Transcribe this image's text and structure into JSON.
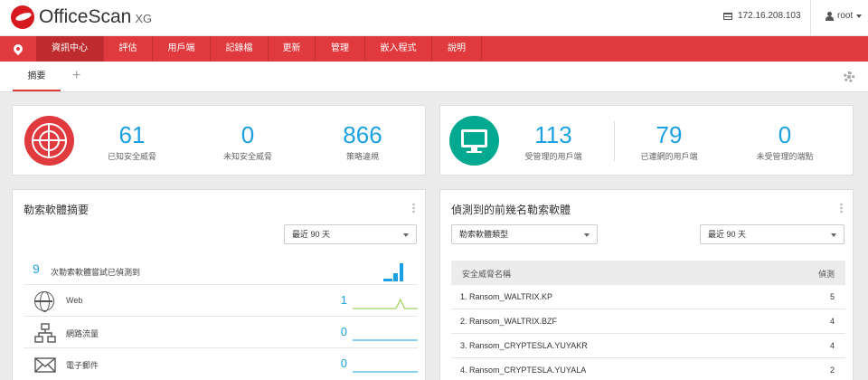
{
  "header": {
    "app_name": "OfficeScan",
    "version": "XG",
    "server_ip": "172.16.208.103",
    "user": "root"
  },
  "nav": {
    "items": [
      {
        "label": "資訊中心",
        "active": true
      },
      {
        "label": "評估"
      },
      {
        "label": "用戶端"
      },
      {
        "label": "記錄檔"
      },
      {
        "label": "更新"
      },
      {
        "label": "管理"
      },
      {
        "label": "嵌入程式"
      },
      {
        "label": "說明"
      }
    ]
  },
  "tabs": {
    "active_label": "摘要",
    "add_label": "+"
  },
  "threat_summary": {
    "stats": [
      {
        "value": "61",
        "label": "已知安全威脅"
      },
      {
        "value": "0",
        "label": "未知安全威脅"
      },
      {
        "value": "866",
        "label": "策略違規"
      }
    ]
  },
  "client_summary": {
    "stats": [
      {
        "value": "113",
        "label": "受管理的用戶端"
      },
      {
        "value": "79",
        "label": "已連網的用戶端"
      },
      {
        "value": "0",
        "label": "未受管理的端點"
      }
    ]
  },
  "ransomware_summary": {
    "title": "勒索軟體摘要",
    "period": "最近 90 天",
    "attempts_value": "9",
    "attempts_label": "次勒索軟體嘗試已偵測到",
    "rows": [
      {
        "label": "Web",
        "value": "1",
        "icon": "globe-icon",
        "spark": [
          0,
          0,
          0,
          0,
          0,
          0,
          0,
          0,
          0,
          0,
          0,
          1,
          0,
          0,
          0,
          0
        ]
      },
      {
        "label": "網路流量",
        "value": "0",
        "icon": "network-icon",
        "spark": [
          0,
          0,
          0,
          0,
          0,
          0,
          0,
          0,
          0,
          0,
          0,
          0,
          0,
          0,
          0,
          0
        ]
      },
      {
        "label": "電子郵件",
        "value": "0",
        "icon": "mail-icon",
        "spark": [
          0,
          0,
          0,
          0,
          0,
          0,
          0,
          0,
          0,
          0,
          0,
          0,
          0,
          0,
          0,
          0
        ]
      }
    ],
    "colors": {
      "accent": "#1ba1e2",
      "spark_web": "#8cc63f",
      "spark_other": "#1ba1e2"
    }
  },
  "top_ransomware": {
    "title": "偵測到的前幾名勒索軟體",
    "type_filter": "勒索軟體類型",
    "period": "最近 90 天",
    "col_name": "安全威脅名稱",
    "col_count": "偵測",
    "rows": [
      {
        "name": "1. Ransom_WALTRIX.KP",
        "count": "5"
      },
      {
        "name": "2. Ransom_WALTRIX.BZF",
        "count": "4"
      },
      {
        "name": "3. Ransom_CRYPTESLA.YUYAKR",
        "count": "4"
      },
      {
        "name": "4. Ransom_CRYPTESLA.YUYALA",
        "count": "2"
      }
    ]
  },
  "colors": {
    "brand_red": "#e03a3e",
    "teal": "#00a98f",
    "number_blue": "#1ba1e2"
  }
}
